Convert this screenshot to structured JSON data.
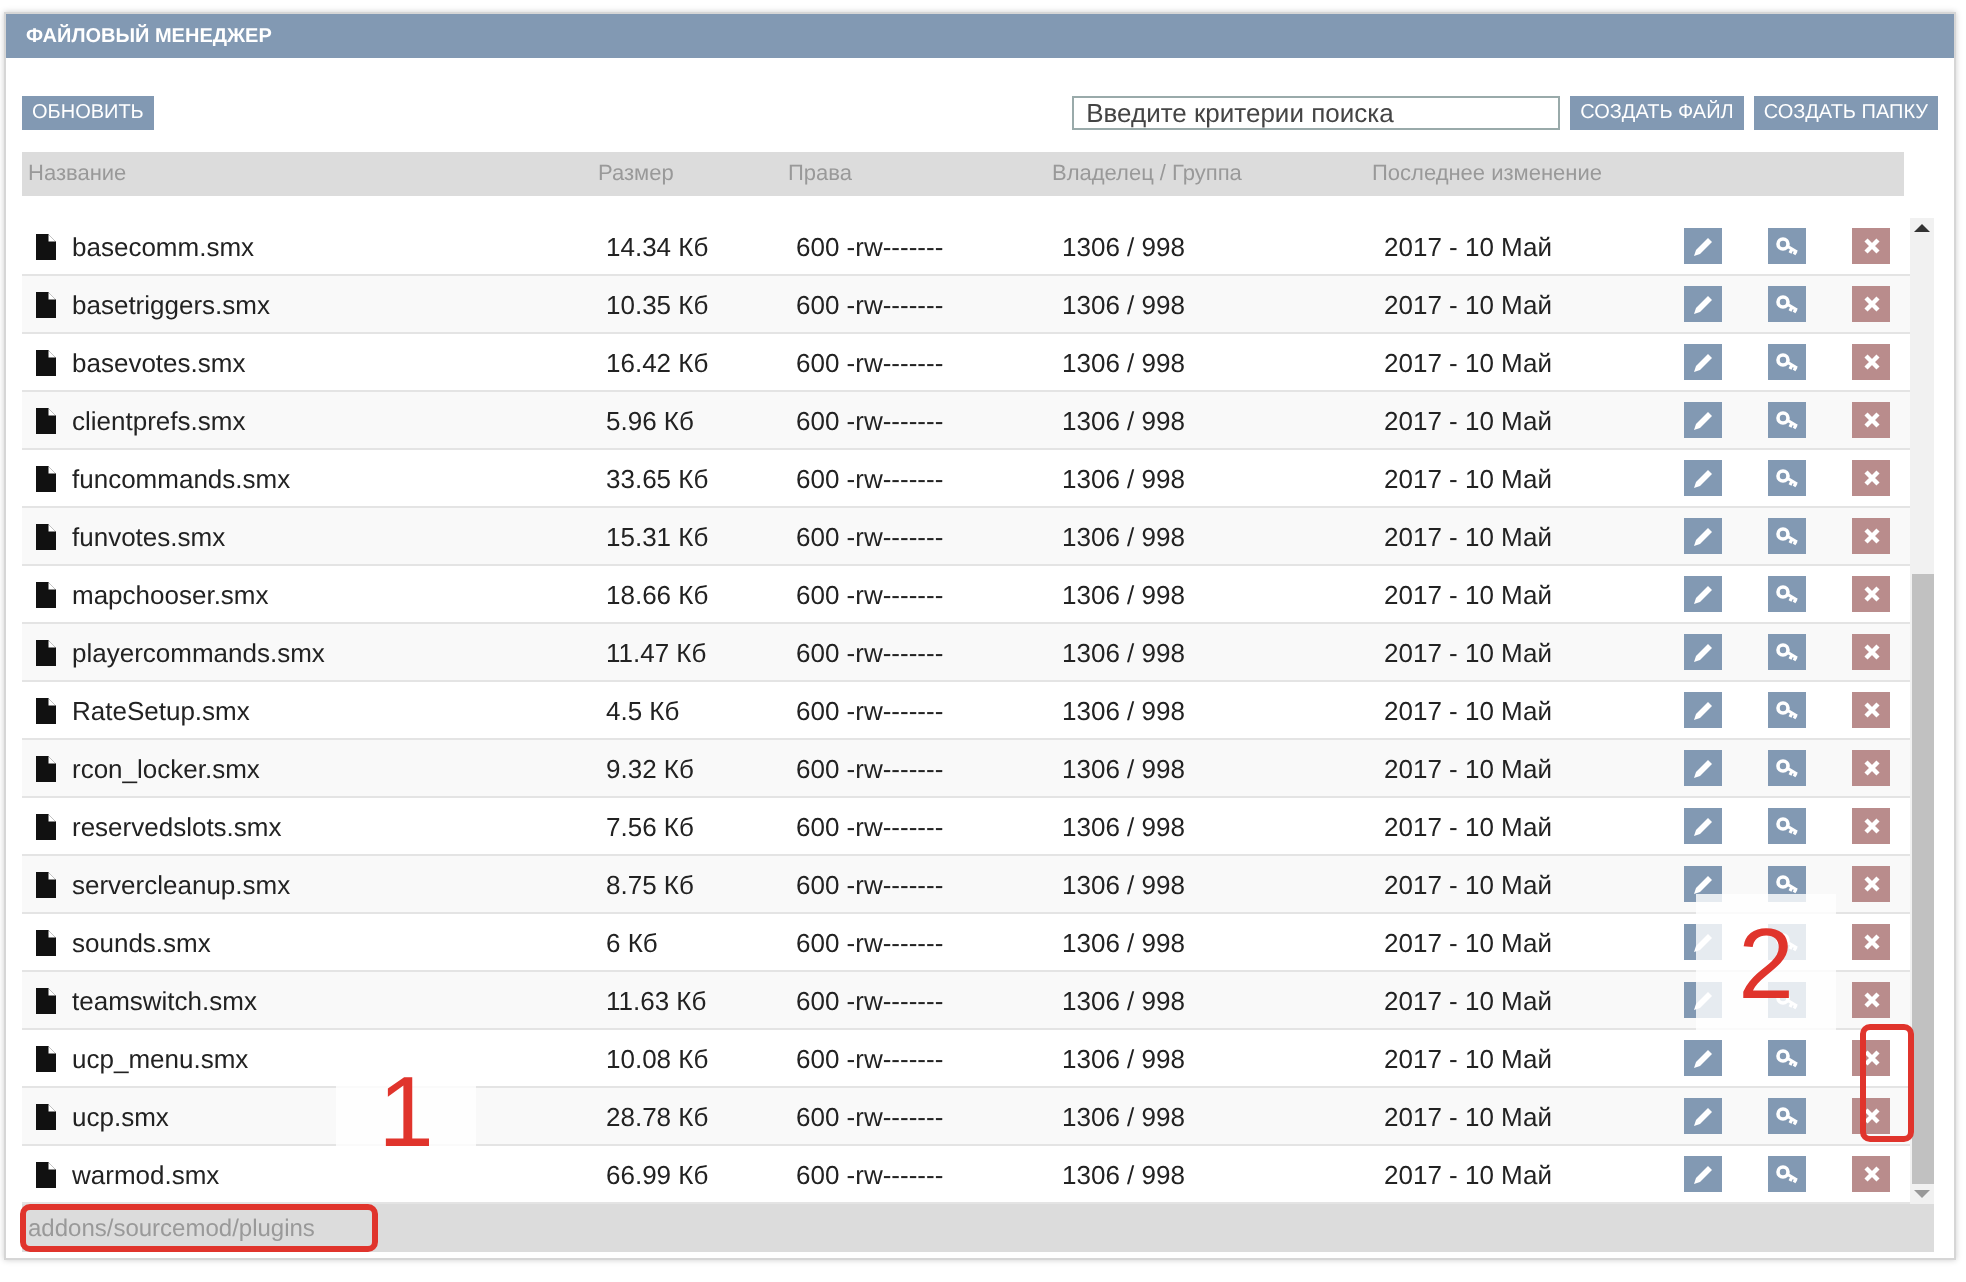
{
  "panel": {
    "title": "ФАЙЛОВЫЙ МЕНЕДЖЕР"
  },
  "toolbar": {
    "refresh": "ОБНОВИТЬ",
    "search": {
      "placeholder": "Введите критерии поиска"
    },
    "buttons": [
      "СОЗДАТЬ ФАЙЛ",
      "СОЗДАТЬ ПАПКУ"
    ]
  },
  "table": {
    "columns": [
      "Название",
      "Размер",
      "Права",
      "Владелец / Группа",
      "Последнее изменение"
    ],
    "rows": [
      {
        "name": "basecomm.smx",
        "size": "14.34 Кб",
        "rights": "600 -rw-------",
        "owner": "1306 / 998",
        "modified": "2017 - 10 Май",
        "highlighted": false
      },
      {
        "name": "basetriggers.smx",
        "size": "10.35 Кб",
        "rights": "600 -rw-------",
        "owner": "1306 / 998",
        "modified": "2017 - 10 Май",
        "highlighted": false
      },
      {
        "name": "basevotes.smx",
        "size": "16.42 Кб",
        "rights": "600 -rw-------",
        "owner": "1306 / 998",
        "modified": "2017 - 10 Май",
        "highlighted": false
      },
      {
        "name": "clientprefs.smx",
        "size": "5.96 Кб",
        "rights": "600 -rw-------",
        "owner": "1306 / 998",
        "modified": "2017 - 10 Май",
        "highlighted": false
      },
      {
        "name": "funcommands.smx",
        "size": "33.65 Кб",
        "rights": "600 -rw-------",
        "owner": "1306 / 998",
        "modified": "2017 - 10 Май",
        "highlighted": false
      },
      {
        "name": "funvotes.smx",
        "size": "15.31 Кб",
        "rights": "600 -rw-------",
        "owner": "1306 / 998",
        "modified": "2017 - 10 Май",
        "highlighted": false
      },
      {
        "name": "mapchooser.smx",
        "size": "18.66 Кб",
        "rights": "600 -rw-------",
        "owner": "1306 / 998",
        "modified": "2017 - 10 Май",
        "highlighted": false
      },
      {
        "name": "playercommands.smx",
        "size": "11.47 Кб",
        "rights": "600 -rw-------",
        "owner": "1306 / 998",
        "modified": "2017 - 10 Май",
        "highlighted": false
      },
      {
        "name": "RateSetup.smx",
        "size": "4.5 Кб",
        "rights": "600 -rw-------",
        "owner": "1306 / 998",
        "modified": "2017 - 10 Май",
        "highlighted": false
      },
      {
        "name": "rcon_locker.smx",
        "size": "9.32 Кб",
        "rights": "600 -rw-------",
        "owner": "1306 / 998",
        "modified": "2017 - 10 Май",
        "highlighted": false
      },
      {
        "name": "reservedslots.smx",
        "size": "7.56 Кб",
        "rights": "600 -rw-------",
        "owner": "1306 / 998",
        "modified": "2017 - 10 Май",
        "highlighted": false
      },
      {
        "name": "servercleanup.smx",
        "size": "8.75 Кб",
        "rights": "600 -rw-------",
        "owner": "1306 / 998",
        "modified": "2017 - 10 Май",
        "highlighted": false
      },
      {
        "name": "sounds.smx",
        "size": "6 Кб",
        "rights": "600 -rw-------",
        "owner": "1306 / 998",
        "modified": "2017 - 10 Май",
        "highlighted": false
      },
      {
        "name": "teamswitch.smx",
        "size": "11.63 Кб",
        "rights": "600 -rw-------",
        "owner": "1306 / 998",
        "modified": "2017 - 10 Май",
        "highlighted": false
      },
      {
        "name": "ucp_menu.smx",
        "size": "10.08 Кб",
        "rights": "600 -rw-------",
        "owner": "1306 / 998",
        "modified": "2017 - 10 Май",
        "highlighted": true
      },
      {
        "name": "ucp.smx",
        "size": "28.78 Кб",
        "rights": "600 -rw-------",
        "owner": "1306 / 998",
        "modified": "2017 - 10 Май",
        "highlighted": true
      },
      {
        "name": "warmod.smx",
        "size": "66.99 Кб",
        "rights": "600 -rw-------",
        "owner": "1306 / 998",
        "modified": "2017 - 10 Май",
        "highlighted": false
      }
    ]
  },
  "path": {
    "text": "addons/sourcemod/plugins",
    "highlighted": true
  },
  "callouts": [
    {
      "label": "1"
    },
    {
      "label": "2"
    }
  ]
}
